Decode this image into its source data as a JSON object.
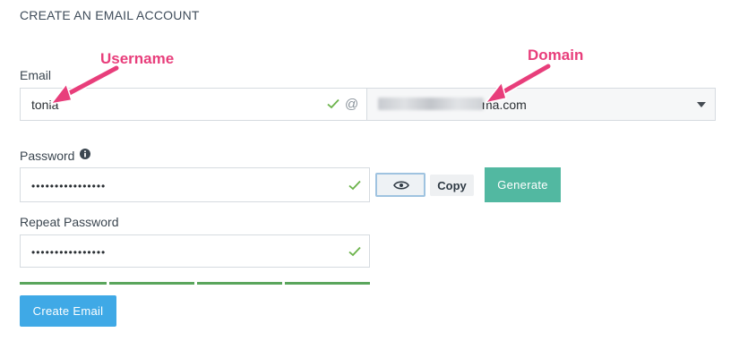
{
  "form": {
    "title": "CREATE AN EMAIL ACCOUNT",
    "email": {
      "label": "Email",
      "username_value": "tonia",
      "at_symbol": "@",
      "domain_value_visible": "ma.com"
    },
    "password": {
      "label": "Password",
      "value_masked": "••••••••••••••••",
      "copy_label": "Copy",
      "generate_label": "Generate"
    },
    "repeat_password": {
      "label": "Repeat Password",
      "value_masked": "••••••••••••••••"
    },
    "strength_meter": {
      "segments_filled": 4,
      "segments_total": 4,
      "color": "#5aa55c"
    },
    "submit_label": "Create Email"
  },
  "annotations": {
    "username_label": "Username",
    "domain_label": "Domain",
    "color": "#e83e7b"
  },
  "colors": {
    "generate_button": "#52b8a1",
    "submit_button": "#3fa9e6",
    "valid_check": "#6bb34a"
  },
  "icons": [
    "check-icon",
    "at-icon",
    "caret-down-icon",
    "info-icon",
    "eye-icon",
    "arrow-icon"
  ]
}
